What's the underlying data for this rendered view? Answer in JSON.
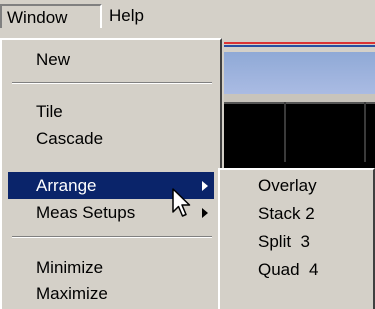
{
  "menubar": {
    "items": [
      {
        "label": "Window"
      },
      {
        "label": "Help"
      }
    ]
  },
  "window_menu": {
    "items": [
      {
        "label": "New"
      },
      {
        "label": "Tile"
      },
      {
        "label": "Cascade"
      },
      {
        "label": "Arrange"
      },
      {
        "label": "Meas Setups"
      },
      {
        "label": "Minimize"
      },
      {
        "label": "Maximize"
      }
    ],
    "highlighted": "Arrange",
    "highlight_color": "#0a246a"
  },
  "arrange_submenu": {
    "items": [
      {
        "label": "Overlay"
      },
      {
        "label": "Stack 2"
      },
      {
        "label": "Split  3"
      },
      {
        "label": "Quad  4"
      }
    ]
  },
  "cursor": {
    "icon": "arrow-pointer-icon"
  }
}
